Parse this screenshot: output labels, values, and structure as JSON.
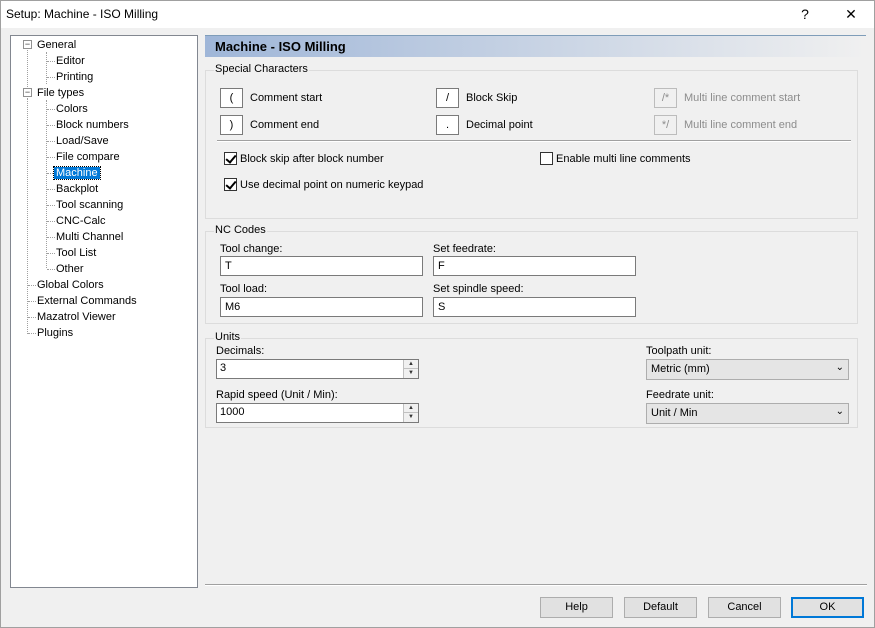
{
  "window": {
    "title": "Setup: Machine - ISO Milling",
    "help_glyph": "?",
    "close_glyph": "✕"
  },
  "tree": {
    "items": [
      {
        "label": "General"
      },
      {
        "label": "Editor"
      },
      {
        "label": "Printing"
      },
      {
        "label": "File types"
      },
      {
        "label": "Colors"
      },
      {
        "label": "Block numbers"
      },
      {
        "label": "Load/Save"
      },
      {
        "label": "File compare"
      },
      {
        "label": "Machine"
      },
      {
        "label": "Backplot"
      },
      {
        "label": "Tool scanning"
      },
      {
        "label": "CNC-Calc"
      },
      {
        "label": "Multi Channel"
      },
      {
        "label": "Tool List"
      },
      {
        "label": "Other"
      },
      {
        "label": "Global Colors"
      },
      {
        "label": "External Commands"
      },
      {
        "label": "Mazatrol Viewer"
      },
      {
        "label": "Plugins"
      }
    ],
    "selected": "Machine",
    "expander_glyph": "−"
  },
  "header": {
    "title": "Machine - ISO Milling"
  },
  "special_chars": {
    "group_title": "Special Characters",
    "comment_start": {
      "char": "(",
      "label": "Comment start"
    },
    "comment_end": {
      "char": ")",
      "label": "Comment end"
    },
    "block_skip": {
      "char": "/",
      "label": "Block Skip"
    },
    "decimal_point": {
      "char": ".",
      "label": "Decimal point"
    },
    "multi_start": {
      "char": "/*",
      "label": "Multi line comment start"
    },
    "multi_end": {
      "char": "*/",
      "label": "Multi line comment end"
    },
    "chk_block_skip": {
      "label": "Block skip after block number",
      "checked": true
    },
    "chk_decimal_keypad": {
      "label": "Use decimal point on numeric keypad",
      "checked": true
    },
    "chk_multi_line": {
      "label": "Enable multi line comments",
      "checked": false
    }
  },
  "nc_codes": {
    "group_title": "NC Codes",
    "tool_change": {
      "label": "Tool change:",
      "value": "T"
    },
    "set_feedrate": {
      "label": "Set feedrate:",
      "value": "F"
    },
    "tool_load": {
      "label": "Tool load:",
      "value": "M6"
    },
    "set_spindle": {
      "label": "Set spindle speed:",
      "value": "S"
    }
  },
  "units": {
    "group_title": "Units",
    "decimals": {
      "label": "Decimals:",
      "value": "3"
    },
    "rapid_speed": {
      "label": "Rapid speed (Unit / Min):",
      "value": "1000"
    },
    "toolpath_unit": {
      "label": "Toolpath unit:",
      "value": "Metric (mm)"
    },
    "feedrate_unit": {
      "label": "Feedrate unit:",
      "value": "Unit / Min"
    }
  },
  "buttons": {
    "help": "Help",
    "default": "Default",
    "cancel": "Cancel",
    "ok": "OK"
  },
  "colors": {
    "selection": "#0078d7",
    "header_gradient_start": "#9fb6d8"
  }
}
